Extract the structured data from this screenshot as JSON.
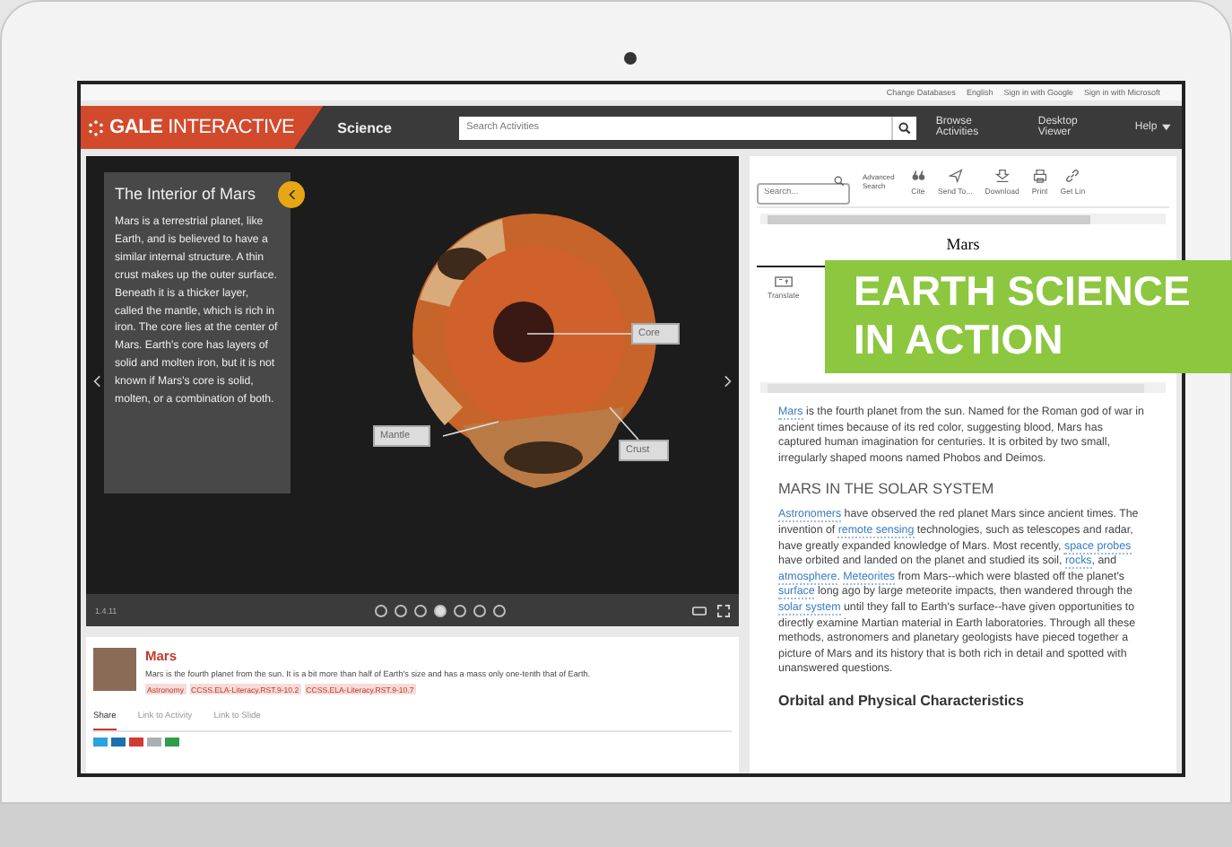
{
  "top_bar": {
    "links": [
      "Change Databases",
      "English",
      "Sign in with Google",
      "Sign in with Microsoft"
    ]
  },
  "nav": {
    "logo": "**GALE** INTERACTIVE",
    "section": "Science",
    "search_placeholder": "Search Activities",
    "links": [
      "Browse Activities",
      "Desktop Viewer",
      "Help"
    ]
  },
  "viewer": {
    "title": "The Interior of Mars",
    "body": "Mars is a terrestrial planet, like Earth, and is believed to have a similar internal structure. A thin crust makes up the outer surface. Beneath it is a thicker layer, called the mantle, which is rich in iron. The core lies at the center of Mars. Earth's core has layers of solid and molten iron, but it is not known if Mars's core is solid, molten, or a combination of both.",
    "labels": [
      {
        "text": "Core"
      },
      {
        "text": "Mantle"
      },
      {
        "text": "Crust"
      }
    ],
    "version": "1.4.11",
    "dots": [
      {
        "selected": false
      },
      {
        "selected": false
      },
      {
        "selected": false
      },
      {
        "selected": true
      },
      {
        "selected": false
      },
      {
        "selected": false
      },
      {
        "selected": false
      }
    ]
  },
  "info": {
    "title": "Mars",
    "description": "Mars is the fourth planet from the sun. It is a bit more than half of Earth's size and has a mass only one-tenth that of Earth.",
    "tags": [
      "Astronomy",
      "CCSS.ELA-Literacy.RST.9-10.2",
      "CCSS.ELA-Literacy.RST.9-10.7"
    ],
    "tabs": [
      {
        "label": "Share",
        "selected": true
      },
      {
        "label": "Link to Activity",
        "selected": false
      },
      {
        "label": "Link to Slide",
        "selected": false
      }
    ],
    "share_buttons": [
      {
        "color": "#2aa3df"
      },
      {
        "color": "#1c6fb0"
      },
      {
        "color": "#d23a30"
      },
      {
        "color": "#a9b1b5"
      },
      {
        "color": "#2e9e47"
      }
    ]
  },
  "article_toolbar": {
    "search_placeholder": "Search...",
    "advanced": "Advanced Search",
    "tools": [
      {
        "kind": "quote",
        "label": "Cite"
      },
      {
        "kind": "send",
        "label": "Send To..."
      },
      {
        "kind": "download",
        "label": "Download"
      },
      {
        "kind": "print",
        "label": "Print"
      },
      {
        "kind": "link",
        "label": "Get Lin"
      }
    ]
  },
  "article": {
    "title": "Mars",
    "tools": [
      {
        "label": "Translate"
      }
    ],
    "blocks": [
      {
        "kind": "paragraph",
        "segments": [
          {
            "text": "Mars",
            "link": true
          },
          {
            "text": " is the fourth planet from the sun. Named for the Roman god of war in ancient times because of its red color, suggesting blood, Mars has captured human imagination for centuries. It is orbited by two small, irregularly shaped moons named Phobos and Deimos.",
            "link": false
          }
        ]
      },
      {
        "kind": "heading",
        "text": "MARS IN THE SOLAR SYSTEM"
      },
      {
        "kind": "paragraph",
        "segments": [
          {
            "text": "Astronomers",
            "link": true
          },
          {
            "text": " have observed the red planet Mars since ancient times. The invention of ",
            "link": false
          },
          {
            "text": "remote sensing",
            "link": true
          },
          {
            "text": " technologies, such as telescopes and radar, have greatly expanded knowledge of Mars. Most recently, ",
            "link": false
          },
          {
            "text": "space probes",
            "link": true
          },
          {
            "text": " have orbited and landed on the planet and studied its soil, ",
            "link": false
          },
          {
            "text": "rocks",
            "link": true
          },
          {
            "text": ", and ",
            "link": false
          },
          {
            "text": "atmosphere",
            "link": true
          },
          {
            "text": ". ",
            "link": false
          },
          {
            "text": "Meteorites",
            "link": true
          },
          {
            "text": " from Mars--which were blasted off the planet's ",
            "link": false
          },
          {
            "text": "surface",
            "link": true
          },
          {
            "text": " long ago by large meteorite impacts, then wandered through the ",
            "link": false
          },
          {
            "text": "solar system",
            "link": true
          },
          {
            "text": " until they fall to Earth's surface--have given opportunities to directly examine Martian material in Earth laboratories. Through all these methods, astronomers and planetary geologists have pieced together a picture of Mars and its history that is both rich in detail and spotted with unanswered questions.",
            "link": false
          }
        ]
      },
      {
        "kind": "subheading",
        "text": "Orbital and Physical Characteristics"
      }
    ]
  },
  "banner": {
    "lines": [
      "EARTH SCIENCE",
      "IN ACTION"
    ]
  }
}
